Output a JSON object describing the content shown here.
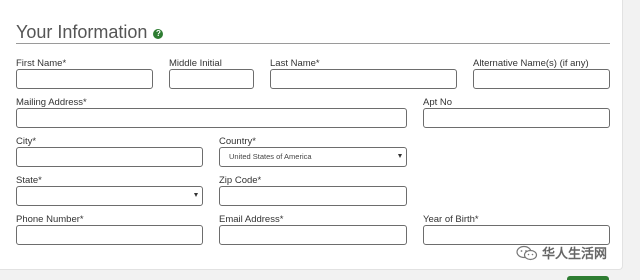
{
  "section": {
    "title": "Your Information",
    "help_icon": "?"
  },
  "fields": {
    "first_name": "First Name*",
    "middle_initial": "Middle Initial",
    "last_name": "Last Name*",
    "alt_names": "Alternative Name(s) (if any)",
    "mailing_address": "Mailing Address*",
    "apt_no": "Apt No",
    "city": "City*",
    "country": "Country*",
    "country_value": "United States of America",
    "state": "State*",
    "zip": "Zip Code*",
    "phone": "Phone Number*",
    "email": "Email Address*",
    "year_of_birth": "Year of Birth*"
  },
  "watermark": {
    "text": "华人生活网",
    "icon": "wechat-icon"
  },
  "colors": {
    "accent": "#2e7d32",
    "border": "#6d6d6d",
    "background": "#f2f2f2"
  }
}
